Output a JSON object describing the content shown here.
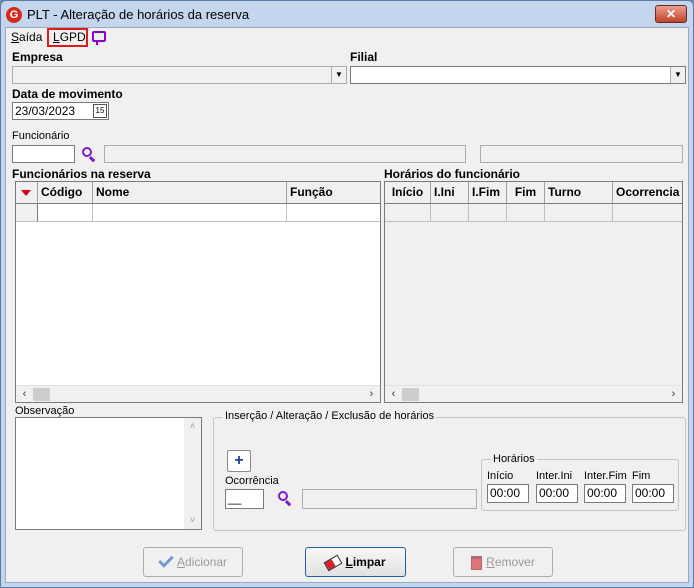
{
  "window": {
    "title": "PLT - Alteração de horários da reserva",
    "logo_letter": "G",
    "close_glyph": "✕"
  },
  "menu": {
    "saida": {
      "u": "S",
      "rest": "aída"
    },
    "lgpd": {
      "u": "L",
      "rest": "GPD"
    }
  },
  "empresa": {
    "label": "Empresa",
    "value": ""
  },
  "filial": {
    "label": "Filial",
    "value": ""
  },
  "data_movimento": {
    "label": "Data de movimento",
    "value": "23/03/2023",
    "calendar_glyph": "15"
  },
  "funcionario": {
    "label": "Funcionário",
    "code": "",
    "name": "",
    "extra": ""
  },
  "funcionarios_grid": {
    "title": "Funcionários na reserva",
    "columns": [
      "Código",
      "Nome",
      "Função"
    ]
  },
  "horarios_grid": {
    "title": "Horários do funcionário",
    "columns": [
      "Início",
      "I.Ini",
      "I.Fim",
      "Fim",
      "Turno",
      "Ocorrencia"
    ]
  },
  "observacao": {
    "label": "Observação",
    "value": ""
  },
  "insercao": {
    "title": "Inserção / Alteração / Exclusão de horários",
    "plus_glyph": "+",
    "ocorrencia_label": "Ocorrência",
    "ocorrencia_code": "__",
    "ocorrencia_desc": "",
    "horarios": {
      "title": "Horários",
      "fields": [
        {
          "label": "Início",
          "value": "00:00"
        },
        {
          "label": "Inter.Ini",
          "value": "00:00"
        },
        {
          "label": "Inter.Fim",
          "value": "00:00"
        },
        {
          "label": "Fim",
          "value": "00:00"
        }
      ]
    }
  },
  "buttons": {
    "adicionar": {
      "u": "A",
      "rest": "dicionar"
    },
    "limpar": {
      "u": "L",
      "rest": "impar"
    },
    "remover": {
      "u": "R",
      "rest": "emover"
    }
  },
  "scroll": {
    "left": "‹",
    "right": "›",
    "up": "˄",
    "down": "˅"
  },
  "colors": {
    "accent_red": "#e01b1b",
    "search_purple": "#7a1fc4",
    "title_bar": "#c4d6ee"
  }
}
